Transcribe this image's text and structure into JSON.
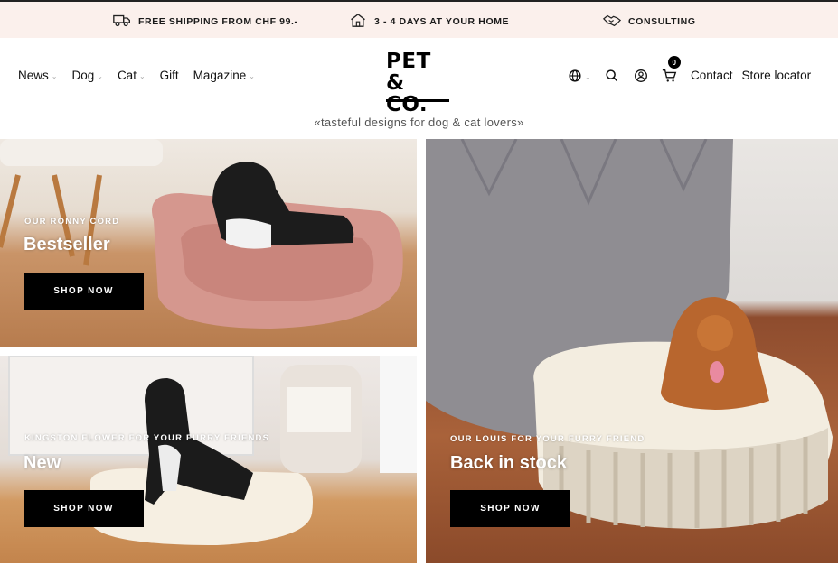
{
  "topbar": {
    "usps": [
      {
        "icon": "truck-icon",
        "text": "FREE SHIPPING FROM CHF 99.-"
      },
      {
        "icon": "house-icon",
        "text": "3 - 4 DAYS AT YOUR HOME"
      },
      {
        "icon": "handshake-icon",
        "text": "CONSULTING"
      }
    ]
  },
  "nav": {
    "items": [
      {
        "label": "News",
        "dropdown": true
      },
      {
        "label": "Dog",
        "dropdown": true
      },
      {
        "label": "Cat",
        "dropdown": true
      },
      {
        "label": "Gift",
        "dropdown": false
      },
      {
        "label": "Magazine",
        "dropdown": true
      }
    ],
    "chevron": "⌄"
  },
  "logo": {
    "line1": "PET",
    "line2": "& CO."
  },
  "tagline": "«tasteful designs for dog & cat lovers»",
  "header_icons": {
    "language": "globe-icon",
    "search": "search-icon",
    "account": "user-icon",
    "cart": "cart-icon",
    "cart_count": "0"
  },
  "header_links": {
    "contact": "Contact",
    "store_locator": "Store locator"
  },
  "tiles": [
    {
      "kicker": "OUR RONNY CORD",
      "headline": "Bestseller",
      "button": "SHOP NOW"
    },
    {
      "kicker": "KINGSTON FLOWER FOR YOUR FURRY FRIENDS",
      "headline": "New",
      "button": "SHOP NOW"
    },
    {
      "kicker": "OUR LOUIS FOR YOUR FURRY FRIEND",
      "headline": "Back in stock",
      "button": "SHOP NOW"
    }
  ],
  "colors": {
    "topbar_bg": "#fbf0ec",
    "button_bg": "#000000",
    "accent_text": "#ffffff"
  }
}
